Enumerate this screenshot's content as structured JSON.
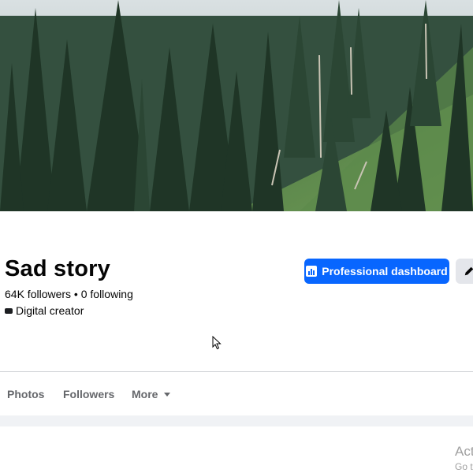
{
  "profile": {
    "name": "Sad story",
    "stats": "64K followers • 0 following",
    "category": "Digital creator"
  },
  "actions": {
    "dashboard_label": "Professional dashboard",
    "dashboard_icon": "bar-chart-icon",
    "edit_icon": "pencil-icon"
  },
  "tabs": [
    {
      "label": "Photos"
    },
    {
      "label": "Followers"
    },
    {
      "label": "More",
      "icon": "caret-down-icon"
    }
  ],
  "watermark": {
    "title": "Act",
    "subtitle": "Go t"
  },
  "colors": {
    "primary": "#0866ff",
    "secondary_button": "#e4e6eb",
    "tab_text": "#65676b"
  }
}
